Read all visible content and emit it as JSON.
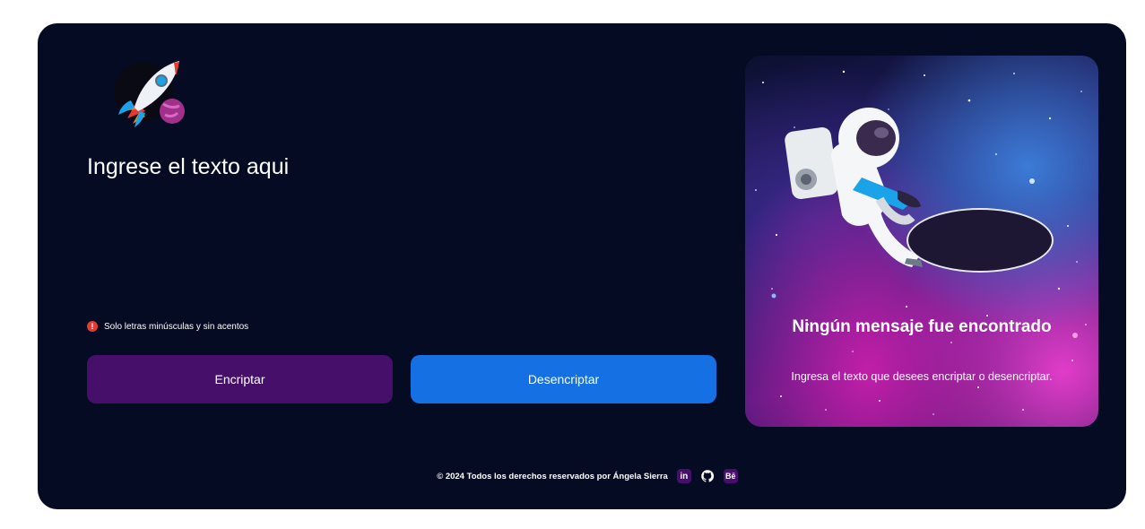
{
  "input": {
    "placeholder": "Ingrese el texto aqui"
  },
  "hint": {
    "text": "Solo letras minúsculas y sin acentos",
    "icon": "exclamation-icon"
  },
  "buttons": {
    "encrypt": "Encriptar",
    "decrypt": "Desencriptar"
  },
  "output": {
    "title": "Ningún mensaje fue encontrado",
    "text": "Ingresa el texto que desees encriptar o desencriptar."
  },
  "footer": {
    "text": "© 2024 Todos los derechos reservados por Ángela Sierra"
  },
  "social": {
    "linkedin": "in",
    "behance": "Bē"
  },
  "colors": {
    "background": "#050b22",
    "encrypt_button": "#46106a",
    "decrypt_button": "#1470e3"
  }
}
